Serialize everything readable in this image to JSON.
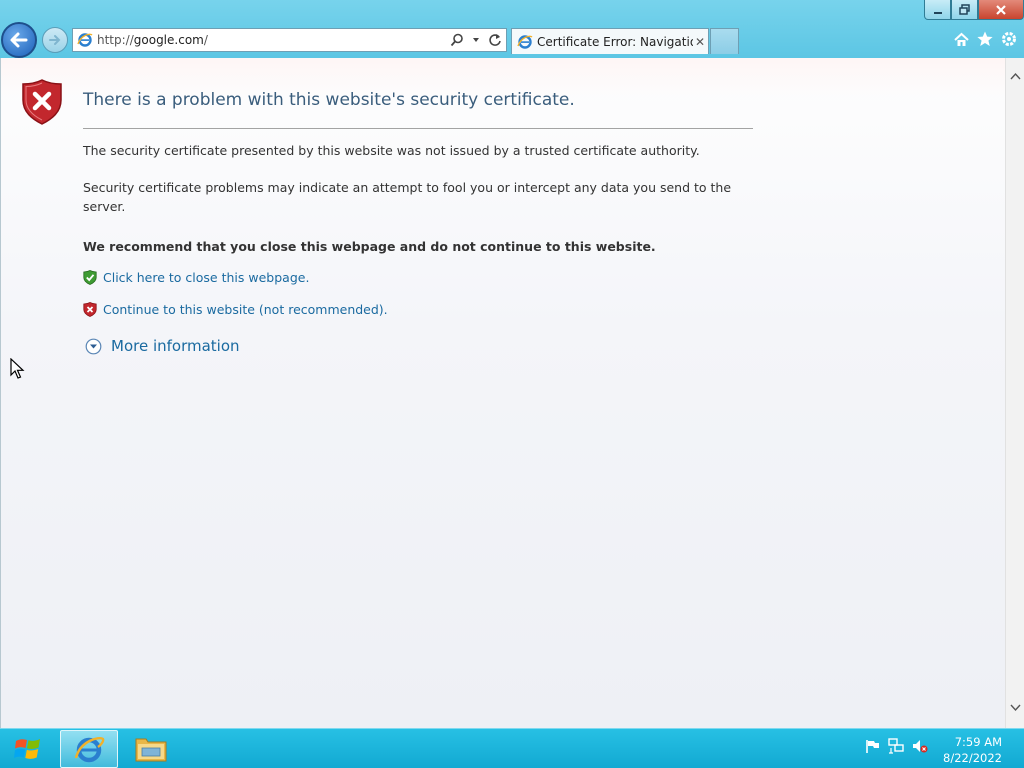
{
  "browser": {
    "address_bar": {
      "url_prefix": "http://",
      "url_domain": "google.com",
      "url_suffix": "/"
    },
    "tab": {
      "title": "Certificate Error: Navigation...",
      "close_glyph": "✕"
    },
    "icons": [
      "back-arrow-icon",
      "forward-arrow-icon",
      "ie-icon",
      "search-icon",
      "dropdown-icon",
      "refresh-icon",
      "home-icon",
      "favorites-star-icon",
      "settings-gear-icon"
    ]
  },
  "window_controls": {
    "minimize": "minimize",
    "restore": "restore",
    "close": "close"
  },
  "page": {
    "title": "There is a problem with this website's security certificate.",
    "paragraph1": "The security certificate presented by this website was not issued by a trusted certificate authority.",
    "paragraph2": "Security certificate problems may indicate an attempt to fool you or intercept any data you send to the server.",
    "recommendation": "We recommend that you close this webpage and do not continue to this website.",
    "link_close": "Click here to close this webpage.",
    "link_continue": "Continue to this website (not recommended).",
    "more_info": "More information"
  },
  "taskbar": {
    "clock_time": "7:59 AM",
    "clock_date": "8/22/2022",
    "tray_icons": [
      "action-center-flag-icon",
      "network-icon",
      "volume-muted-icon"
    ]
  },
  "colors": {
    "accent": "#1a6aa0",
    "title": "#3a5d7c",
    "taskbar": "#12a9d2",
    "chrome": "#5cc6e4"
  }
}
